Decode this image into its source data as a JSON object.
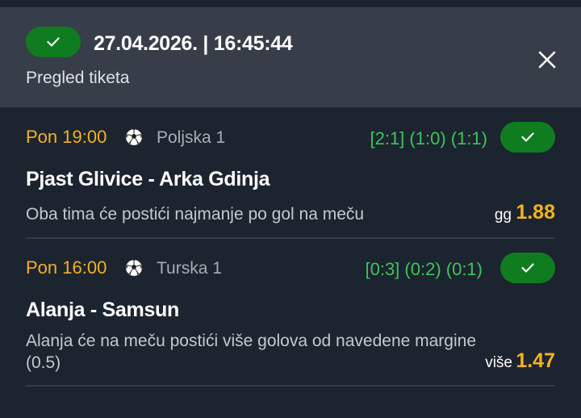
{
  "header": {
    "status_icon": "check-icon",
    "datetime": "27.04.2026. | 16:45:44",
    "subtitle": "Pregled tiketa",
    "close_icon": "close-icon"
  },
  "matches": [
    {
      "time": "Pon 19:00",
      "sport_icon": "soccer-ball-icon",
      "league": "Poljska 1",
      "score": "[2:1] (1:0) (1:1)",
      "status_icon": "check-icon",
      "teams": "Pjast Glivice - Arka Gdinja",
      "bet_description": "Oba tima će postići najmanje po gol na meču",
      "bet_code": "gg",
      "odds": "1.88"
    },
    {
      "time": "Pon 16:00",
      "sport_icon": "soccer-ball-icon",
      "league": "Turska 1",
      "score": "[0:3] (0:2) (0:1)",
      "status_icon": "check-icon",
      "teams": "Alanja - Samsun",
      "bet_description": "Alanja će na meču postići više golova od navedene margine (0.5)",
      "bet_code": "više",
      "odds": "1.47"
    }
  ],
  "colors": {
    "background": "#1c2430",
    "header_bg": "#373e49",
    "win_green": "#0f7d1f",
    "score_green": "#3ec45a",
    "accent_yellow": "#f5b21b"
  }
}
